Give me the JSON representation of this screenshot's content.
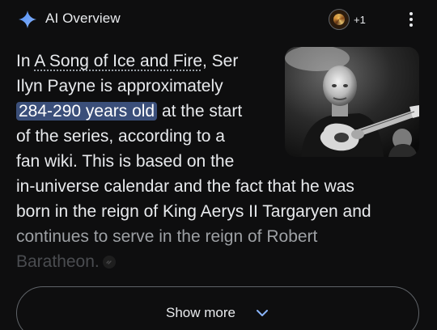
{
  "header": {
    "title": "AI Overview",
    "sources_more": "+1"
  },
  "answer": {
    "l1_pre": "In ",
    "l1_link": "A Song of Ice and Fire",
    "l1_post": ", Ser",
    "l2": "Ilyn Payne is approximately",
    "l3_highlight": "284-290 years old",
    "l3_post": " at the start",
    "l4": "of the series, according to a",
    "l5": "fan wiki. This is based on the",
    "l6": "in-universe calendar and the fact that he was",
    "l7": "born in the reign of King Aerys II Targaryen and",
    "l8": "continues to serve in the reign of Robert",
    "l9": "Baratheon."
  },
  "show_more": {
    "label": "Show more"
  }
}
